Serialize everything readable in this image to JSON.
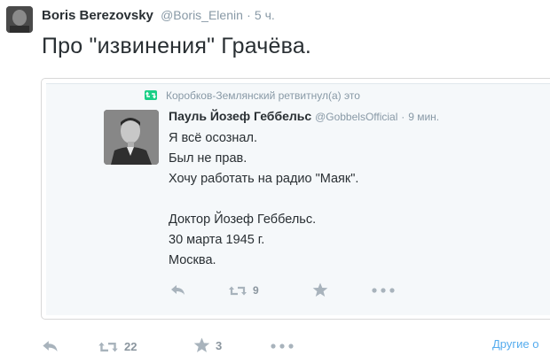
{
  "tweet": {
    "author_name": "Boris Berezovsky",
    "author_handle": "@Boris_Elenin",
    "separator": "·",
    "time": "5 ч.",
    "text": "Про \"извинения\" Грачёва.",
    "actions": {
      "retweet_count": "22",
      "favorite_count": "3",
      "more_label": "Другие о"
    }
  },
  "quoted": {
    "retweet_notice": "Коробков-Землянский ретвитнул(а) это",
    "author_name": "Пауль Йозеф Геббельс",
    "author_handle": "@GobbelsOfficial",
    "separator": "·",
    "time": "9 мин.",
    "lines": [
      "Я всё осознал.",
      "Был не прав.",
      "Хочу работать на радио \"Маяк\".",
      "",
      "Доктор Йозеф Геббельс.",
      "30 марта 1945 г.",
      "Москва."
    ],
    "actions": {
      "retweet_count": "9"
    }
  },
  "icons": {
    "reply": "reply-icon",
    "retweet": "retweet-icon",
    "favorite": "star-icon",
    "more": "more-dots-icon"
  },
  "colors": {
    "link": "#55acee",
    "retweet_green": "#19cf86",
    "muted": "#8899a6"
  }
}
